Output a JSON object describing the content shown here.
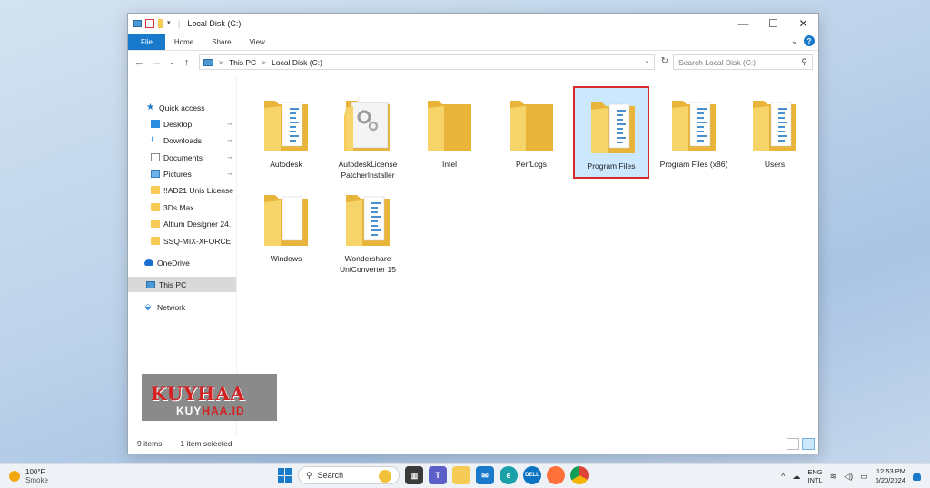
{
  "window": {
    "title": "Local Disk (C:)",
    "controls": {
      "minimize": "—",
      "maximize": "☐",
      "close": "✕"
    }
  },
  "ribbon": {
    "tabs": [
      "File",
      "Home",
      "Share",
      "View"
    ],
    "expand": "⌄",
    "help": "?"
  },
  "nav": {
    "back": "←",
    "forward": "→",
    "recent": "⌄",
    "up": "↑",
    "address": [
      "This PC",
      "Local Disk (C:)"
    ],
    "separator": ">",
    "refresh": "↻",
    "search_placeholder": "Search Local Disk (C:)"
  },
  "sidebar": {
    "items": [
      {
        "label": "Quick access",
        "icon": "star-icon",
        "pinned": false
      },
      {
        "label": "Desktop",
        "icon": "desktop-icon",
        "pinned": true
      },
      {
        "label": "Downloads",
        "icon": "download-icon",
        "pinned": true
      },
      {
        "label": "Documents",
        "icon": "documents-icon",
        "pinned": true
      },
      {
        "label": "Pictures",
        "icon": "pictures-icon",
        "pinned": true
      },
      {
        "label": "!!AD21 Unis License",
        "icon": "folder-icon",
        "pinned": false
      },
      {
        "label": "3Ds Max",
        "icon": "folder-icon",
        "pinned": false
      },
      {
        "label": "Altium Designer 24.",
        "icon": "folder-icon",
        "pinned": false
      },
      {
        "label": "SSQ-MIX-XFORCE",
        "icon": "folder-icon",
        "pinned": false
      },
      {
        "label": "OneDrive",
        "icon": "onedrive-icon",
        "pinned": false
      },
      {
        "label": "This PC",
        "icon": "this-pc-icon",
        "pinned": false,
        "selected": true
      },
      {
        "label": "Network",
        "icon": "network-icon",
        "pinned": false
      }
    ],
    "pin_glyph": "📌"
  },
  "files": [
    {
      "name": "Autodesk",
      "type": "docs"
    },
    {
      "name": "AutodeskLicense PatcherInstaller",
      "type": "gears"
    },
    {
      "name": "Intel",
      "type": "plain"
    },
    {
      "name": "PerfLogs",
      "type": "plain"
    },
    {
      "name": "Program Files",
      "type": "docs",
      "selected": true
    },
    {
      "name": "Program Files (x86)",
      "type": "docs"
    },
    {
      "name": "Users",
      "type": "docs"
    },
    {
      "name": "Windows",
      "type": "white"
    },
    {
      "name": "Wondershare UniConverter 15",
      "type": "docs"
    }
  ],
  "status": {
    "count": "9 items",
    "selected": "1 item selected"
  },
  "watermark": {
    "line1": "KUYHAA",
    "line2": "KUYHAA.ID"
  },
  "taskbar": {
    "temp": "100°F",
    "weather": "Smoke",
    "search": "Search",
    "lang1": "ENG",
    "lang2": "INTL",
    "time": "12:53 PM",
    "date": "6/20/2024",
    "apps": [
      "teams-icon",
      "files-icon",
      "mail-icon",
      "edge-icon",
      "dell-icon",
      "firefox-icon",
      "chrome-icon"
    ]
  },
  "colors": {
    "accent": "#1979ca",
    "folder": "#f5cb55",
    "selection_border": "#d62b2b",
    "selection_fill": "#cce8ff"
  }
}
